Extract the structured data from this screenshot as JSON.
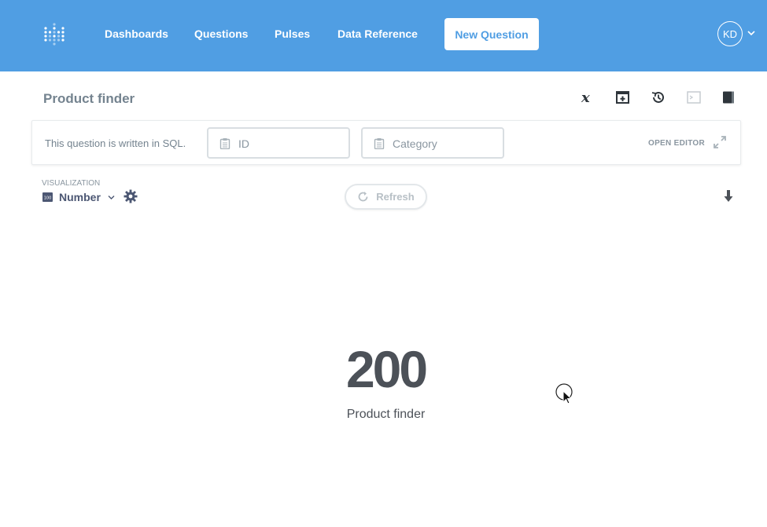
{
  "nav": {
    "links": [
      {
        "label": "Dashboards"
      },
      {
        "label": "Questions"
      },
      {
        "label": "Pulses"
      },
      {
        "label": "Data Reference"
      }
    ],
    "new_question": "New Question",
    "user_initials": "KD",
    "icons": [
      "metabase-logo-icon",
      "chevron-down-icon"
    ]
  },
  "question": {
    "title": "Product finder",
    "header_icons": [
      "variable-x-icon",
      "add-to-dashboard-icon",
      "history-icon",
      "sql-console-icon",
      "reference-book-icon"
    ]
  },
  "params": {
    "sql_note": "This question is written in SQL.",
    "fields": [
      {
        "placeholder": "ID"
      },
      {
        "placeholder": "Category"
      }
    ],
    "open_editor": "OPEN EDITOR"
  },
  "visualization": {
    "label": "VISUALIZATION",
    "type": "Number",
    "refresh": "Refresh"
  },
  "scalar": {
    "value": "200",
    "title": "Product finder"
  },
  "colors": {
    "nav_bg": "#509ee3",
    "accent": "#509ee3",
    "text_dark": "#4c5158",
    "text_muted": "#74838f"
  }
}
